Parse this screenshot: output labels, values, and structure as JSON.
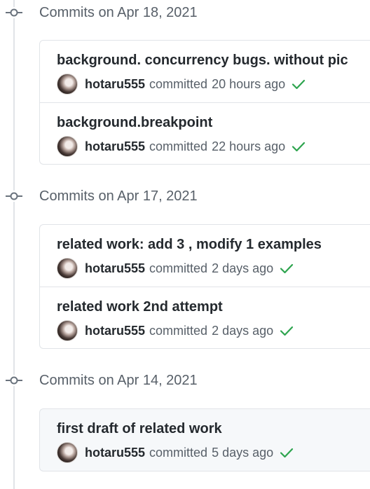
{
  "groups": [
    {
      "title": "Commits on Apr 18, 2021",
      "commits": [
        {
          "message": "background. concurrency bugs. without pic",
          "author": "hotaru555",
          "action": "committed",
          "time": "20 hours ago",
          "status": "success"
        },
        {
          "message": "background.breakpoint",
          "author": "hotaru555",
          "action": "committed",
          "time": "22 hours ago",
          "status": "success"
        }
      ]
    },
    {
      "title": "Commits on Apr 17, 2021",
      "commits": [
        {
          "message": "related work: add 3 , modify 1 examples",
          "author": "hotaru555",
          "action": "committed",
          "time": "2 days ago",
          "status": "success"
        },
        {
          "message": "related work 2nd attempt",
          "author": "hotaru555",
          "action": "committed",
          "time": "2 days ago",
          "status": "success"
        }
      ]
    },
    {
      "title": "Commits on Apr 14, 2021",
      "commits": [
        {
          "message": "first draft of related work",
          "author": "hotaru555",
          "action": "committed",
          "time": "5 days ago",
          "status": "success"
        }
      ]
    }
  ],
  "icons": {
    "group_node": "git-commit-icon",
    "status": "check-icon",
    "avatar": "user-avatar"
  },
  "colors": {
    "success": "#2da44e",
    "muted_text": "#586069",
    "border": "#e1e4e8",
    "timeline": "#e1e4e8"
  }
}
